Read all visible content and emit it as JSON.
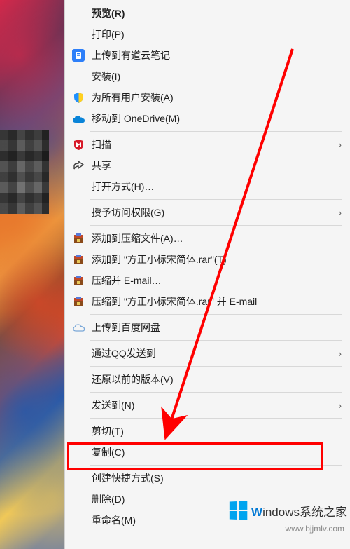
{
  "menu": {
    "preview": "预览(R)",
    "print": "打印(P)",
    "youdao": "上传到有道云笔记",
    "install": "安装(I)",
    "install_all": "为所有用户安装(A)",
    "onedrive": "移动到 OneDrive(M)",
    "scan": "扫描",
    "share": "共享",
    "open_with": "打开方式(H)…",
    "grant_access": "授予访问权限(G)",
    "add_archive": "添加到压缩文件(A)…",
    "add_rar": "添加到 \"方正小标宋简体.rar\"(T)",
    "compress_email": "压缩并 E-mail…",
    "compress_to_email": "压缩到 \"方正小标宋简体.rar\" 并 E-mail",
    "baidu": "上传到百度网盘",
    "qq_send": "通过QQ发送到",
    "restore": "还原以前的版本(V)",
    "send_to": "发送到(N)",
    "cut": "剪切(T)",
    "copy": "复制(C)",
    "shortcut": "创建快捷方式(S)",
    "delete": "删除(D)",
    "rename": "重命名(M)"
  },
  "watermark": {
    "brand_prefix": "W",
    "brand_rest": "indows",
    "brand_suffix": "系统之家",
    "url": "www.bjjmlv.com"
  }
}
